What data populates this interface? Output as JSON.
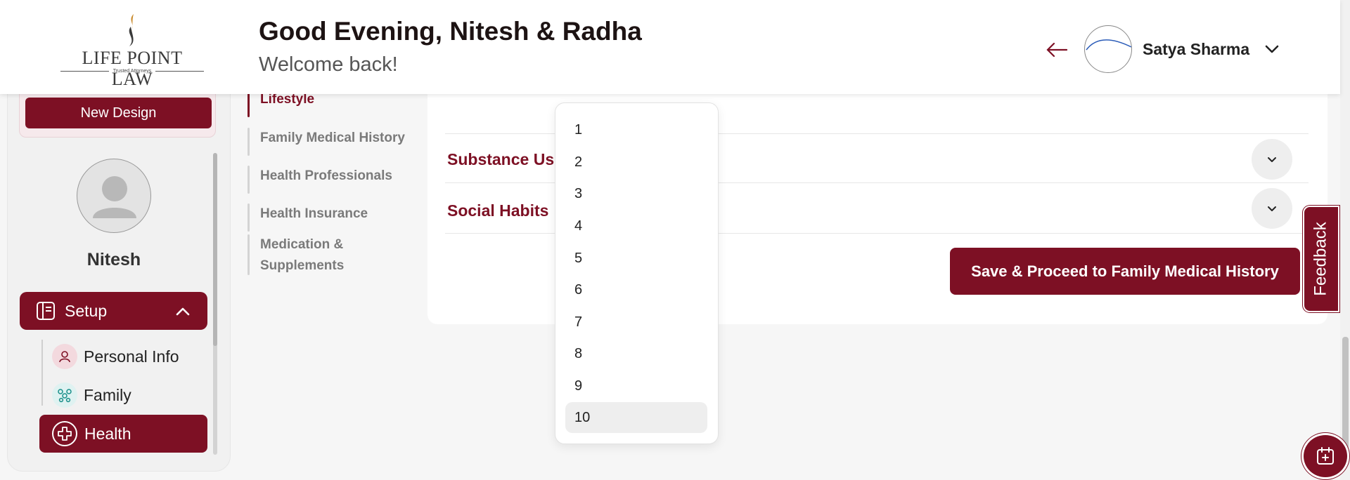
{
  "brand": {
    "name": "LIFE POINT LAW",
    "tagline": "Trusted Attorneys"
  },
  "header": {
    "greeting": "Good Evening, Nitesh & Radha",
    "welcome": "Welcome back!",
    "user_name": "Satya Sharma"
  },
  "sidebar": {
    "new_design": "New Design",
    "profile_name": "Nitesh",
    "setup_label": "Setup",
    "items": [
      {
        "label": "Personal Info",
        "icon": "person-icon"
      },
      {
        "label": "Family",
        "icon": "family-icon"
      },
      {
        "label": "Health",
        "icon": "health-cross-icon",
        "active": true
      }
    ]
  },
  "steps": [
    {
      "label": "Lifestyle",
      "active": true
    },
    {
      "label": "Family Medical History"
    },
    {
      "label": "Health Professionals"
    },
    {
      "label": "Health Insurance"
    },
    {
      "label": "Medication &",
      "label2": "Supplements"
    }
  ],
  "sections": [
    {
      "title": "Substance Us"
    },
    {
      "title": "Social Habits"
    }
  ],
  "save_button": "Save & Proceed to Family Medical History",
  "dropdown": {
    "options": [
      "1",
      "2",
      "3",
      "4",
      "5",
      "6",
      "7",
      "8",
      "9",
      "10"
    ],
    "selected": "10"
  },
  "feedback_label": "Feedback",
  "colors": {
    "primary": "#7d1024",
    "background": "#f6f6f6",
    "card": "#ffffff"
  }
}
